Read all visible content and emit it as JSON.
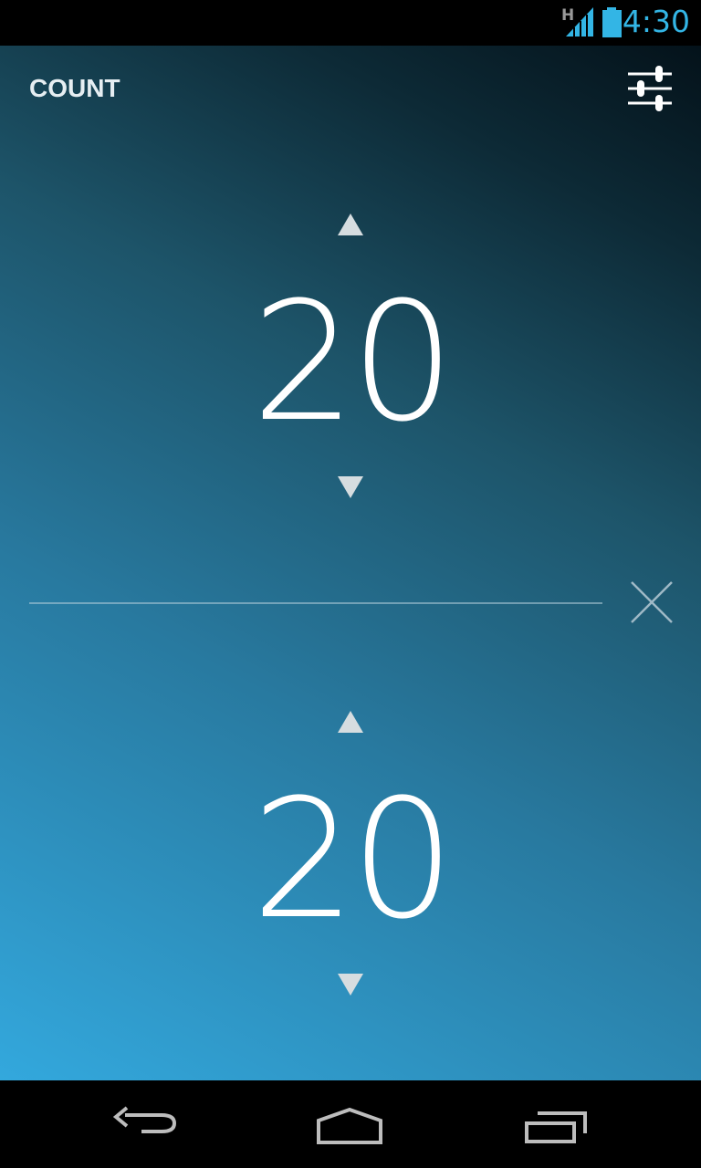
{
  "status_bar": {
    "network_type": "H",
    "time": "4:30",
    "signal_icon": "signal-icon",
    "battery_icon": "battery-icon",
    "accent_color": "#33b5e5"
  },
  "app": {
    "title": "COUNT",
    "settings_icon": "sliders-icon"
  },
  "counters": [
    {
      "value": "20",
      "increment_icon": "triangle-up-icon",
      "decrement_icon": "triangle-down-icon"
    },
    {
      "value": "20",
      "increment_icon": "triangle-up-icon",
      "decrement_icon": "triangle-down-icon"
    }
  ],
  "clear_icon": "close-icon",
  "nav_bar": {
    "back_icon": "back-icon",
    "home_icon": "home-icon",
    "recents_icon": "recents-icon"
  }
}
